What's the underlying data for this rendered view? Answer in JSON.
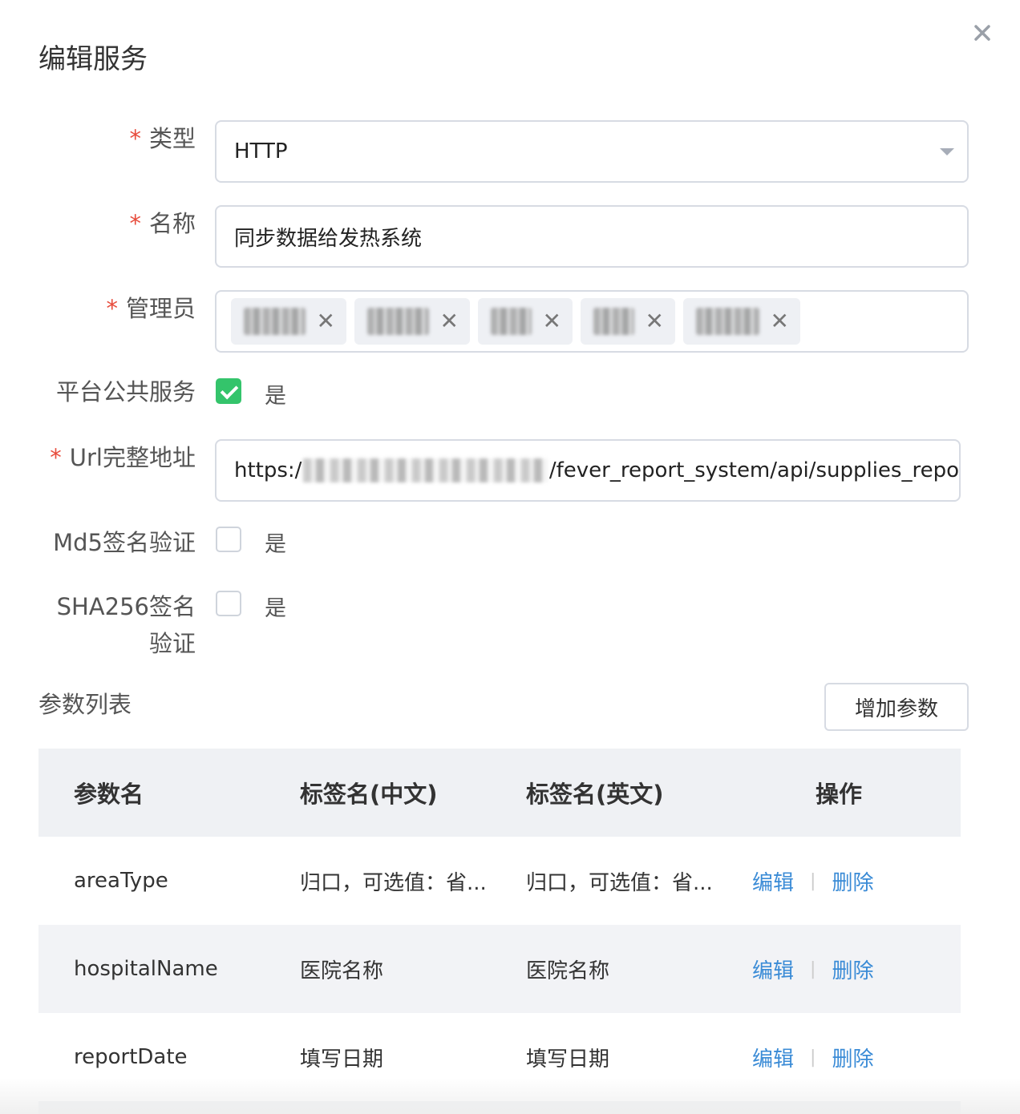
{
  "dialog": {
    "title": "编辑服务"
  },
  "form": {
    "type": {
      "label": "类型",
      "required_mark": "*",
      "value": "HTTP"
    },
    "name": {
      "label": "名称",
      "required_mark": "*",
      "value": "同步数据给发热系统"
    },
    "admins": {
      "label": "管理员",
      "required_mark": "*",
      "tags": [
        "",
        "",
        "",
        "",
        ""
      ],
      "remove_glyph": "✕"
    },
    "platform_public": {
      "label": "平台公共服务",
      "checked": true,
      "option": "是"
    },
    "url": {
      "label": "Url完整地址",
      "required_mark": "*",
      "prefix": "https:/",
      "suffix": "/fever_report_system/api/supplies_repo"
    },
    "md5": {
      "label": "Md5签名验证",
      "checked": false,
      "option": "是"
    },
    "sha256": {
      "label_line1": "SHA256签名",
      "label_line2": "验证",
      "checked": false,
      "option": "是"
    }
  },
  "params": {
    "section_title": "参数列表",
    "add_button": "增加参数",
    "columns": [
      "参数名",
      "标签名(中文)",
      "标签名(英文)",
      "操作"
    ],
    "rows": [
      {
        "name": "areaType",
        "label_cn": "归口，可选值：省...",
        "label_en": "归口，可选值：省..."
      },
      {
        "name": "hospitalName",
        "label_cn": "医院名称",
        "label_en": "医院名称"
      },
      {
        "name": "reportDate",
        "label_cn": "填写日期",
        "label_en": "填写日期"
      }
    ],
    "actions": {
      "edit": "编辑",
      "delete": "删除",
      "separator": "|"
    }
  },
  "colors": {
    "accent_link": "#3a8bd6",
    "check_green": "#34c46b",
    "required_red": "#e74c3c"
  },
  "icons": [
    "close-icon",
    "chevron-down-icon",
    "tag-remove-icon",
    "checkmark-icon"
  ]
}
